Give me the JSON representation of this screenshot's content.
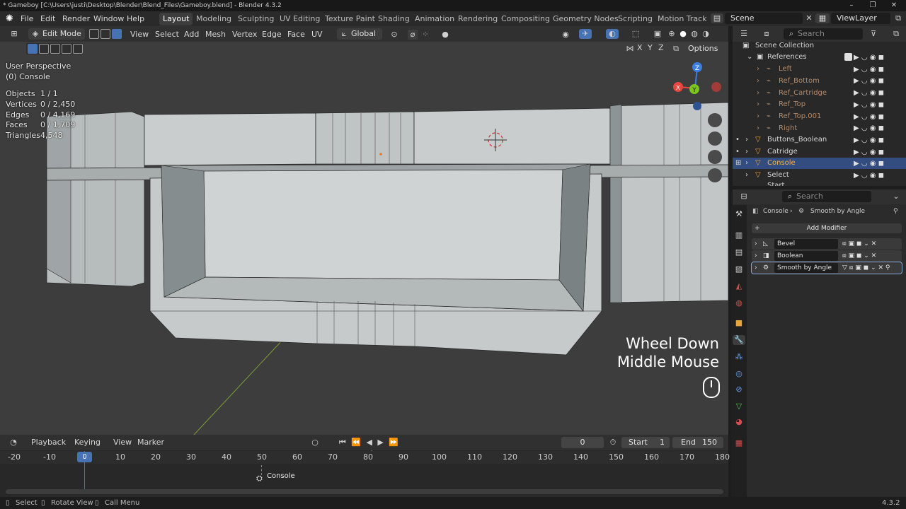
{
  "window": {
    "title": "* Gameboy [C:\\Users\\justi\\Desktop\\Blender\\Blend_Files\\Gameboy.blend] - Blender 4.3.2",
    "controls": [
      "–",
      "❐",
      "✕"
    ]
  },
  "menubar": {
    "items": [
      "File",
      "Edit",
      "Render",
      "Window",
      "Help"
    ],
    "workspaces": [
      "Layout",
      "Modeling",
      "Sculpting",
      "UV Editing",
      "Texture Paint",
      "Shading",
      "Animation",
      "Rendering",
      "Compositing",
      "Geometry Nodes",
      "Scripting",
      "Motion Tracki"
    ],
    "active_workspace": "Layout",
    "scene": "Scene",
    "view_layer": "ViewLayer"
  },
  "viewport_header": {
    "mode": "Edit Mode",
    "menus": [
      "View",
      "Select",
      "Add",
      "Mesh",
      "Vertex",
      "Edge",
      "Face",
      "UV"
    ],
    "transform_orientation": "Global",
    "axes": [
      "X",
      "Y",
      "Z"
    ],
    "options_label": "Options"
  },
  "viewport": {
    "perspective": "User Perspective",
    "object_label": "(0) Console",
    "stats": [
      {
        "label": "Objects",
        "value": "1 / 1"
      },
      {
        "label": "Vertices",
        "value": "0 / 2,450"
      },
      {
        "label": "Edges",
        "value": "0 / 4,169"
      },
      {
        "label": "Faces",
        "value": "0 / 1,709"
      },
      {
        "label": "Triangles",
        "value": "4,548"
      }
    ],
    "keystroke_line1": "Wheel Down",
    "keystroke_line2": "Middle Mouse",
    "gizmo": {
      "x": "X",
      "y": "Y",
      "z": "Z"
    },
    "colors": {
      "x_axis": "#e8463f",
      "y_axis": "#7bc51d",
      "z_axis": "#3d7fe0",
      "mesh": "#c7cccc",
      "background": "#3d3d3d"
    }
  },
  "outliner": {
    "search_placeholder": "Search",
    "rows": [
      {
        "label": "Scene Collection"
      },
      {
        "label": "References"
      },
      {
        "label": "Left"
      },
      {
        "label": "Ref_Bottom"
      },
      {
        "label": "Ref_Cartridge"
      },
      {
        "label": "Ref_Top"
      },
      {
        "label": "Ref_Top.001"
      },
      {
        "label": "Right"
      },
      {
        "label": "Buttons_Boolean"
      },
      {
        "label": "Catridge"
      },
      {
        "label": "Console"
      },
      {
        "label": "Select"
      },
      {
        "label": "Start"
      }
    ],
    "selected": "Console"
  },
  "properties": {
    "search_placeholder": "Search",
    "breadcrumb_object": "Console",
    "breadcrumb_modifier": "Smooth by Angle",
    "add_modifier_label": "Add Modifier",
    "modifiers": [
      {
        "name": "Bevel"
      },
      {
        "name": "Boolean"
      },
      {
        "name": "Smooth by Angle"
      }
    ]
  },
  "timeline": {
    "menus": [
      "Playback",
      "Keying",
      "View",
      "Marker"
    ],
    "current_frame": "0",
    "start_label": "Start",
    "start": "1",
    "end_label": "End",
    "end": "150",
    "ruler": [
      "-20",
      "-10",
      "0",
      "10",
      "20",
      "30",
      "40",
      "50",
      "60",
      "70",
      "80",
      "90",
      "100",
      "110",
      "120",
      "130",
      "140",
      "150",
      "160",
      "170",
      "180"
    ],
    "playhead_label": "0",
    "object_marker": "Console"
  },
  "statusbar": {
    "items": [
      "Select",
      "Rotate View",
      "Call Menu"
    ],
    "version": "4.3.2"
  }
}
